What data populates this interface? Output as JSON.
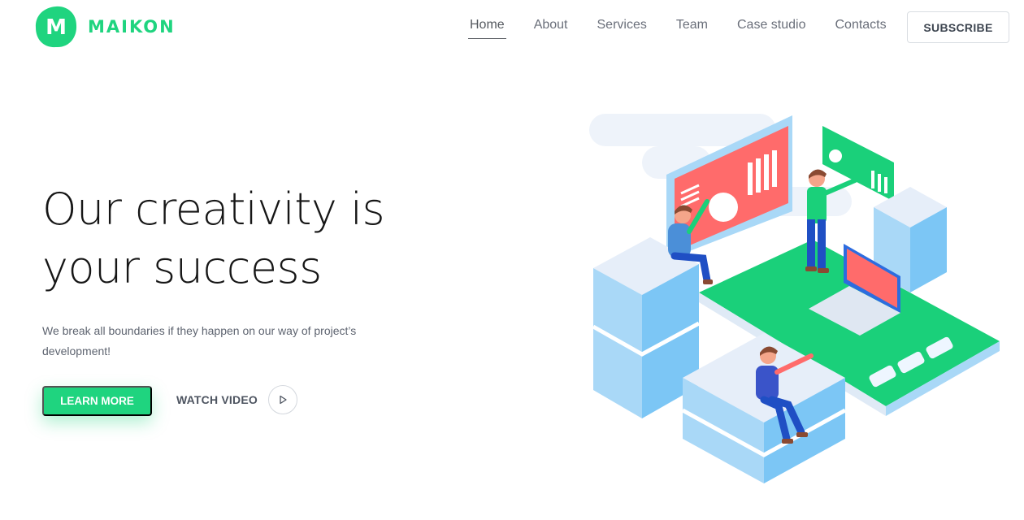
{
  "brand": {
    "logo_letter": "M",
    "name": "MAIKON",
    "color": "#1fd47f"
  },
  "nav": {
    "items": [
      {
        "label": "Home",
        "active": true
      },
      {
        "label": "About",
        "active": false
      },
      {
        "label": "Services",
        "active": false
      },
      {
        "label": "Team",
        "active": false
      },
      {
        "label": "Case studio",
        "active": false
      },
      {
        "label": "Contacts",
        "active": false
      }
    ],
    "subscribe_label": "SUBSCRIBE"
  },
  "hero": {
    "title_line1": "Our creativity is",
    "title_line2": "your success",
    "subtitle": "We break all boundaries if they happen on our way of project’s development!",
    "learn_more_label": "LEARN MORE",
    "watch_video_label": "WATCH VIDEO",
    "play_icon": "play-icon"
  },
  "illustration": {
    "subject": "isometric-team-workspace",
    "accent_green": "#1ad07a",
    "accent_red": "#ff6b6b",
    "accent_blue": "#7cc6f5"
  }
}
